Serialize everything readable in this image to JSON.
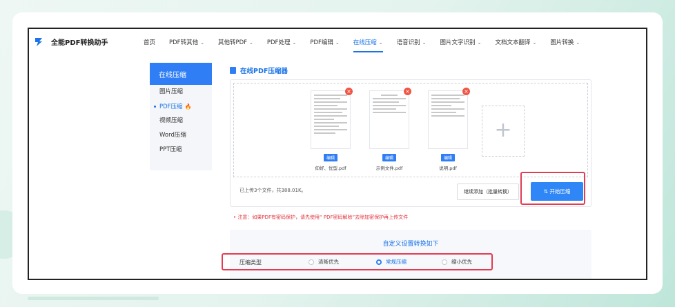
{
  "brand": {
    "name": "全能PDF转换助手"
  },
  "nav": {
    "items": [
      {
        "label": "首页",
        "has_chevron": false
      },
      {
        "label": "PDF转其他",
        "has_chevron": true
      },
      {
        "label": "其他转PDF",
        "has_chevron": true
      },
      {
        "label": "PDF处理",
        "has_chevron": true
      },
      {
        "label": "PDF编辑",
        "has_chevron": true
      },
      {
        "label": "在线压缩",
        "has_chevron": true,
        "active": true
      },
      {
        "label": "语音识别",
        "has_chevron": true
      },
      {
        "label": "图片文字识别",
        "has_chevron": true
      },
      {
        "label": "文档文本翻译",
        "has_chevron": true
      },
      {
        "label": "图片转换",
        "has_chevron": true
      }
    ],
    "chevron_glyph": "⌄"
  },
  "sidebar": {
    "title": "在线压缩",
    "items": [
      {
        "label": "图片压缩"
      },
      {
        "label": "PDF压缩",
        "active": true,
        "badge_icon": "fire-icon"
      },
      {
        "label": "视频压缩"
      },
      {
        "label": "Word压缩"
      },
      {
        "label": "PPT压缩"
      }
    ]
  },
  "main": {
    "title": "在线PDF压缩器"
  },
  "upload": {
    "files": [
      {
        "name": "仰好、优型.pdf",
        "tag": "编辑"
      },
      {
        "name": "示例文件.pdf",
        "tag": "编辑"
      },
      {
        "name": "说明.pdf",
        "tag": "编辑"
      }
    ],
    "add_glyph": "+",
    "delete_glyph": "×",
    "status": "已上传3个文件，共388.01K。",
    "continue_button": "继续添加（批量转换）",
    "start_button": "开始压缩",
    "start_icon": "swap-icon"
  },
  "notice": "• 注意：如果PDF有密码保护，请先使用“ PDF密码解除”去除加密保护再上传文件",
  "settings": {
    "title": "自定义设置转换如下",
    "type_label": "压缩类型",
    "options": [
      {
        "label": "清晰优先",
        "checked": false
      },
      {
        "label": "常规压缩",
        "checked": true
      },
      {
        "label": "缩小优先",
        "checked": false
      }
    ]
  },
  "colors": {
    "accent": "#2f7ef5",
    "highlight": "#e33b52",
    "warning": "#e0303a"
  }
}
